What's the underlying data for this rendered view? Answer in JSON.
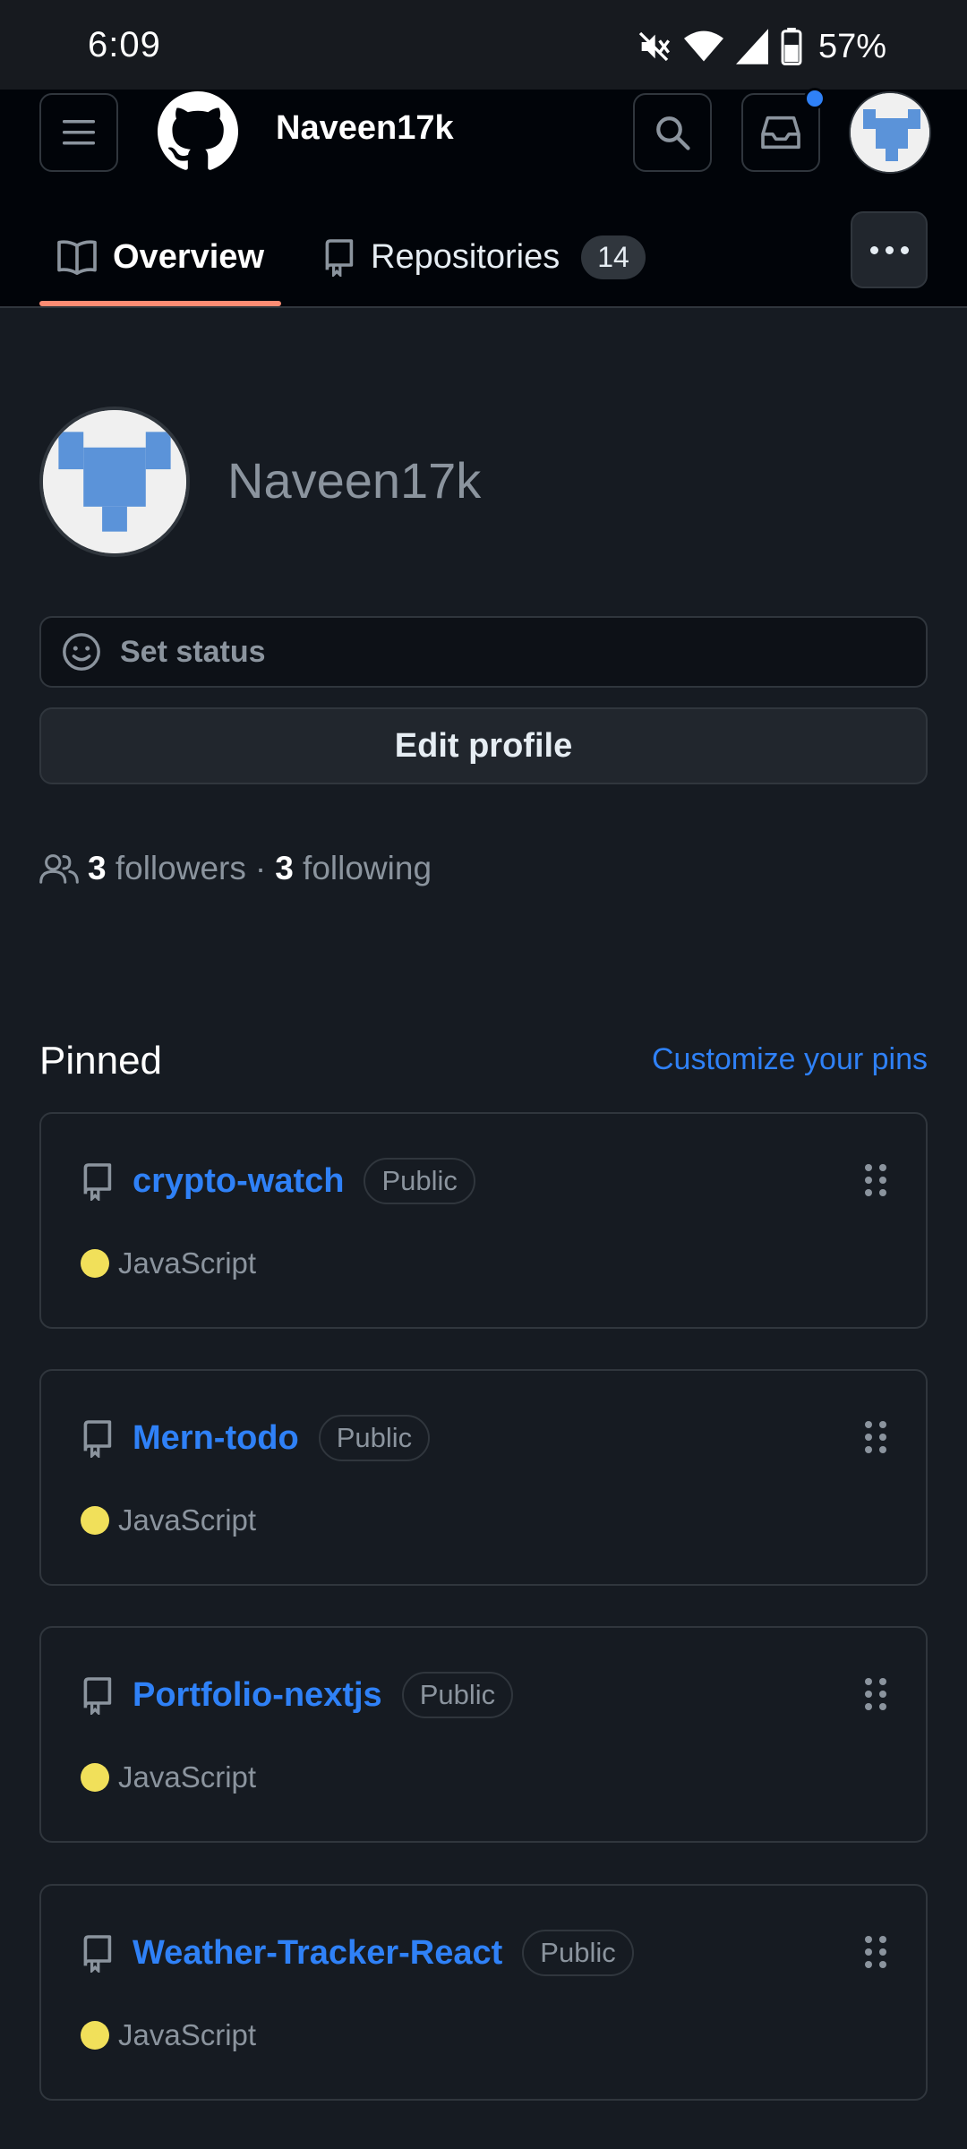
{
  "status_bar": {
    "time": "6:09",
    "battery": "57%"
  },
  "header": {
    "username": "Naveen17k",
    "tabs": [
      {
        "label": "Overview"
      },
      {
        "label": "Repositories",
        "count": "14"
      }
    ]
  },
  "profile": {
    "name": "Naveen17k",
    "set_status": "Set status",
    "edit_profile": "Edit profile",
    "followers_count": "3",
    "followers_label": "followers",
    "separator": "·",
    "following_count": "3",
    "following_label": "following"
  },
  "pinned": {
    "title": "Pinned",
    "customize": "Customize your pins",
    "items": [
      {
        "name": "crypto-watch",
        "visibility": "Public",
        "language": "JavaScript"
      },
      {
        "name": "Mern-todo",
        "visibility": "Public",
        "language": "JavaScript"
      },
      {
        "name": "Portfolio-nextjs",
        "visibility": "Public",
        "language": "JavaScript"
      },
      {
        "name": "Weather-Tracker-React",
        "visibility": "Public",
        "language": "JavaScript"
      }
    ]
  },
  "colors": {
    "accent_link": "#2f81f7",
    "tab_underline": "#fd8c73",
    "javascript": "#f1e05a",
    "background": "#161b22"
  }
}
